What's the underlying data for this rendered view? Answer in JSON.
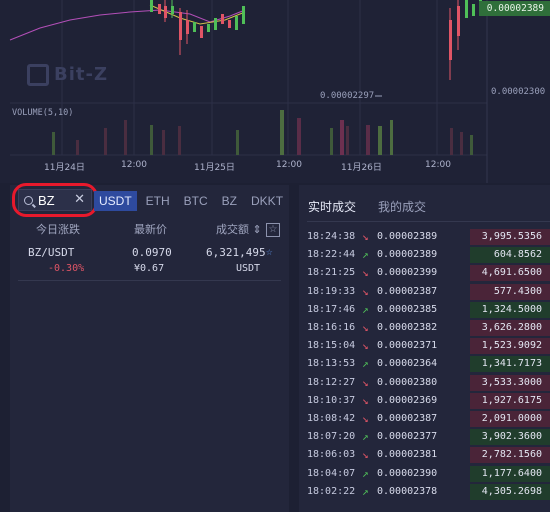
{
  "chart": {
    "current_price": "0.00002389",
    "low_marker": "0.00002297",
    "axis_price": "0.00002300",
    "volume_label": "VOLUME(5,10)",
    "watermark": "Bit-Z",
    "x_labels": [
      "11月24日",
      "12:00",
      "11月25日",
      "12:00",
      "11月26日",
      "12:00"
    ]
  },
  "market": {
    "search_value": "BZ",
    "tabs": [
      "USDT",
      "ETH",
      "BTC",
      "BZ",
      "DKKT"
    ],
    "active_tab": "USDT",
    "headers": {
      "change": "今日涨跌",
      "last": "最新价",
      "volume": "成交额 ⇕"
    },
    "row": {
      "pair": "BZ/USDT",
      "change": "-0.30%",
      "price": "0.0970",
      "price_cny": "¥0.67",
      "volume": "6,321,495",
      "volume_unit": "USDT"
    }
  },
  "trades": {
    "tabs": [
      "实时成交",
      "我的成交"
    ],
    "rows": [
      {
        "time": "18:24:38",
        "dir": "down",
        "price": "0.00002389",
        "amount": "3,995.5356"
      },
      {
        "time": "18:22:44",
        "dir": "up",
        "price": "0.00002389",
        "amount": "604.8562"
      },
      {
        "time": "18:21:25",
        "dir": "down",
        "price": "0.00002399",
        "amount": "4,691.6500"
      },
      {
        "time": "18:19:33",
        "dir": "down",
        "price": "0.00002387",
        "amount": "577.4300"
      },
      {
        "time": "18:17:46",
        "dir": "up",
        "price": "0.00002385",
        "amount": "1,324.5000"
      },
      {
        "time": "18:16:16",
        "dir": "down",
        "price": "0.00002382",
        "amount": "3,626.2800"
      },
      {
        "time": "18:15:04",
        "dir": "down",
        "price": "0.00002371",
        "amount": "1,523.9092"
      },
      {
        "time": "18:13:53",
        "dir": "up",
        "price": "0.00002364",
        "amount": "1,341.7173"
      },
      {
        "time": "18:12:27",
        "dir": "down",
        "price": "0.00002380",
        "amount": "3,533.3000"
      },
      {
        "time": "18:10:37",
        "dir": "down",
        "price": "0.00002369",
        "amount": "1,927.6175"
      },
      {
        "time": "18:08:42",
        "dir": "down",
        "price": "0.00002387",
        "amount": "2,091.0000"
      },
      {
        "time": "18:07:20",
        "dir": "up",
        "price": "0.00002377",
        "amount": "3,902.3600"
      },
      {
        "time": "18:06:03",
        "dir": "down",
        "price": "0.00002381",
        "amount": "2,782.1560"
      },
      {
        "time": "18:04:07",
        "dir": "up",
        "price": "0.00002390",
        "amount": "1,177.6400"
      },
      {
        "time": "18:02:22",
        "dir": "up",
        "price": "0.00002378",
        "amount": "4,305.2698"
      }
    ]
  },
  "colors": {
    "up": "#4fbf58",
    "down": "#e05566",
    "accent": "#2e4a9e"
  }
}
